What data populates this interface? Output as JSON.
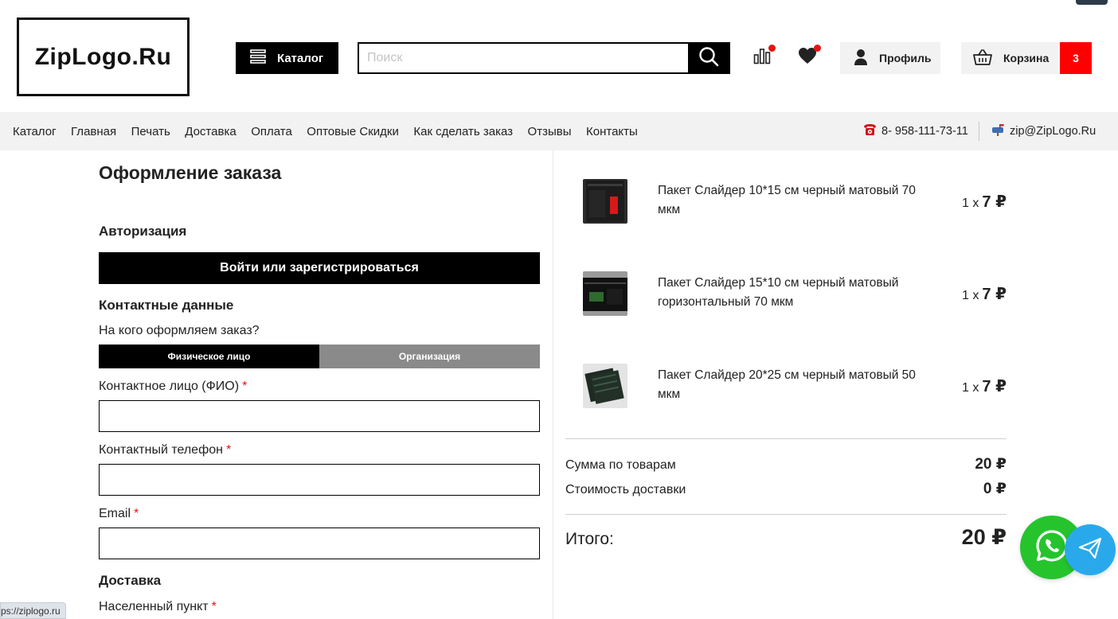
{
  "header": {
    "logo_text": "ZipLogo.Ru",
    "catalog_label": "Каталог",
    "search_placeholder": "Поиск",
    "profile_label": "Профиль",
    "cart_label": "Корзина",
    "cart_count": "3",
    "icons": [
      "menu-icon",
      "search-icon",
      "compare-icon",
      "heart-icon",
      "user-icon",
      "basket-icon"
    ]
  },
  "nav": {
    "links": [
      "Каталог",
      "Главная",
      "Печать",
      "Доставка",
      "Оплата",
      "Оптовые Скидки",
      "Как сделать заказ",
      "Отзывы",
      "Контакты"
    ],
    "phone": "8- 958-111-73-11",
    "email": "zip@ZipLogo.Ru"
  },
  "form": {
    "title": "Оформление заказа",
    "auth_title": "Авторизация",
    "login_button": "Войти или зарегистрироваться",
    "contacts_title": "Контактные данные",
    "who_label": "На кого оформляем заказ?",
    "toggle": [
      "Физическое лицо",
      "Организация"
    ],
    "toggle_selected": "Физическое лицо",
    "fields": [
      {
        "label": "Контактное лицо (ФИО)",
        "required": "*",
        "value": ""
      },
      {
        "label": "Контактный телефон",
        "required": "*",
        "value": ""
      },
      {
        "label": "Email",
        "required": "*",
        "value": ""
      }
    ],
    "delivery_title": "Доставка",
    "city_label": "Населенный пункт",
    "city_required": "*"
  },
  "cart": {
    "items": [
      {
        "name": "Пакет Слайдер 10*15 см черный матовый 70 мкм",
        "qty": "1 x",
        "price": "7 ₽"
      },
      {
        "name": "Пакет Слайдер 15*10 см черный матовый горизонтальный 70 мкм",
        "qty": "1 x",
        "price": "7 ₽"
      },
      {
        "name": "Пакет Слайдер 20*25 см черный матовый 50 мкм",
        "qty": "1 x",
        "price": "7 ₽"
      }
    ],
    "subtotal_label": "Сумма по товарам",
    "subtotal_value": "20 ₽",
    "delivery_label": "Стоимость доставки",
    "delivery_value": "0 ₽",
    "total_label": "Итого:",
    "total_value": "20 ₽"
  },
  "status_url": "ps://ziplogo.ru",
  "colors": {
    "accent": "#000000",
    "badge_red": "#ff0000",
    "required_red": "#e41313",
    "whatsapp": "#25c42d",
    "telegram": "#29a9eb",
    "toggle_inactive": "#8a8a8a"
  }
}
